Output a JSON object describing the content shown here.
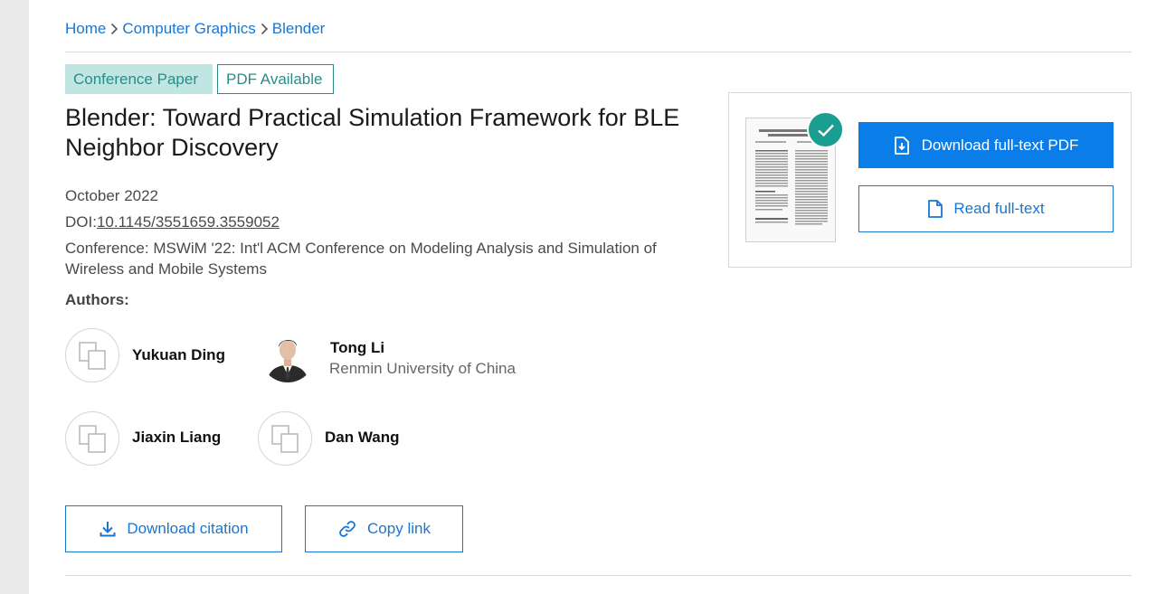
{
  "breadcrumb": {
    "items": [
      "Home",
      "Computer Graphics",
      "Blender"
    ]
  },
  "badges": {
    "type": "Conference Paper",
    "availability": "PDF Available"
  },
  "paper": {
    "title": "Blender: Toward Practical Simulation Framework for BLE Neighbor Discovery",
    "date": "October 2022",
    "doi_label": "DOI:",
    "doi": "10.1145/3551659.3559052",
    "conference": "Conference: MSWiM '22: Int'l ACM Conference on Modeling Analysis and Simulation of Wireless and Mobile Systems"
  },
  "authors": {
    "heading": "Authors:",
    "list": [
      {
        "name": "Yukuan Ding",
        "affiliation": ""
      },
      {
        "name": "Tong Li",
        "affiliation": "Renmin University of China"
      },
      {
        "name": "Jiaxin Liang",
        "affiliation": ""
      },
      {
        "name": "Dan Wang",
        "affiliation": ""
      }
    ]
  },
  "actions": {
    "download_citation": "Download citation",
    "copy_link": "Copy link"
  },
  "fulltext": {
    "download_pdf": "Download full-text PDF",
    "read": "Read full-text"
  },
  "icons": {
    "breadcrumb_separator": "chevron-right-icon",
    "placeholder_avatar": "placeholder-avatar-icon",
    "download": "download-icon",
    "link": "link-icon",
    "pdf_file": "pdf-file-icon",
    "document": "document-icon",
    "check": "check-icon"
  },
  "colors": {
    "link": "#1976d2",
    "primary_button": "#0a7de8",
    "badge_teal": "#2a8c86",
    "badge_bg": "#bfe6e3",
    "check_badge": "#1a9e8f"
  }
}
